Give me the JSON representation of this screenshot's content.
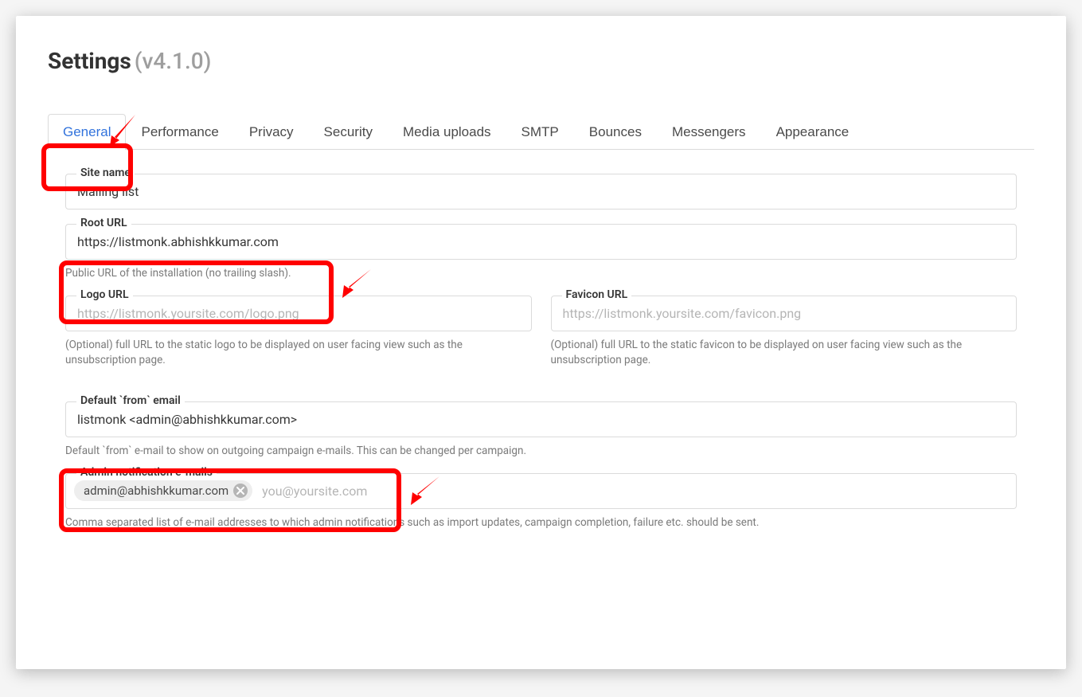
{
  "header": {
    "title": "Settings",
    "version": "(v4.1.0)"
  },
  "tabs": {
    "general": "General",
    "performance": "Performance",
    "privacy": "Privacy",
    "security": "Security",
    "media": "Media uploads",
    "smtp": "SMTP",
    "bounces": "Bounces",
    "messengers": "Messengers",
    "appearance": "Appearance"
  },
  "fields": {
    "site_name": {
      "label": "Site name",
      "value": "Mailing list"
    },
    "root_url": {
      "label": "Root URL",
      "value": "https://listmonk.abhishkkumar.com",
      "help": "Public URL of the installation (no trailing slash)."
    },
    "logo_url": {
      "label": "Logo URL",
      "placeholder": "https://listmonk.yoursite.com/logo.png",
      "help": "(Optional) full URL to the static logo to be displayed on user facing view such as the unsubscription page."
    },
    "favicon_url": {
      "label": "Favicon URL",
      "placeholder": "https://listmonk.yoursite.com/favicon.png",
      "help": "(Optional) full URL to the static favicon to be displayed on user facing view such as the unsubscription page."
    },
    "from_email": {
      "label": "Default `from` email",
      "value": "listmonk <admin@abhishkkumar.com>",
      "help": "Default `from` e-mail to show on outgoing campaign e-mails. This can be changed per campaign."
    },
    "admin_emails": {
      "label": "Admin notification e-mails",
      "tag": "admin@abhishkkumar.com",
      "placeholder": "you@yoursite.com",
      "help": "Comma separated list of e-mail addresses to which admin notifications such as import updates, campaign completion, failure etc. should be sent."
    }
  }
}
